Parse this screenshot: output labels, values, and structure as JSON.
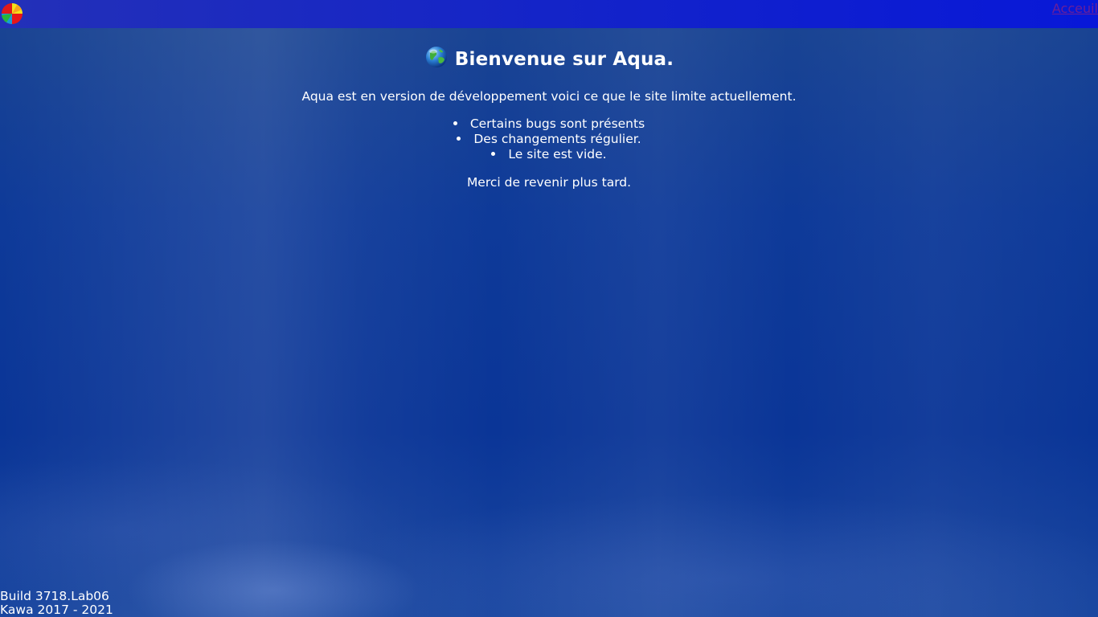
{
  "header": {
    "logo_icon": "color-wheel-logo-icon",
    "home_link_label": "Acceuil",
    "home_link_color": "#6a1f9a"
  },
  "main": {
    "globe_icon": "globe-icon",
    "title": "Bienvenue sur Aqua.",
    "intro": "Aqua est en version de développement voici ce que le site limite actuellement.",
    "bullets": [
      "Certains bugs sont présents",
      "Des changements régulier.",
      "Le site est vide."
    ],
    "closing": "Merci de revenir plus tard."
  },
  "footer": {
    "build": "Build 3718.Lab06",
    "copyright": "Kawa 2017 - 2021"
  },
  "colors": {
    "background": "#0e3a99",
    "topbar": "#1424c8",
    "text": "#ffffff"
  }
}
